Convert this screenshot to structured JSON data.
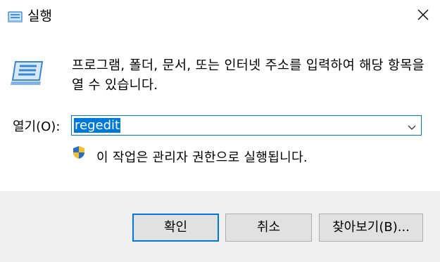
{
  "window": {
    "title": "실행",
    "close_icon": "close-icon",
    "app_icon": "run-icon"
  },
  "main": {
    "description_line1": "프로그램, 폴더, 문서, 또는 인터넷 주소를 입력하여 해당 항목을",
    "description_line2": "열 수 있습니다.",
    "open_label": "열기(O):",
    "open_value": "regedit",
    "admin_note": "이 작업은 관리자 권한으로 실행됩니다."
  },
  "buttons": {
    "ok": "확인",
    "cancel": "취소",
    "browse": "찾아보기(B)..."
  },
  "colors": {
    "accent": "#0078d7",
    "footer": "#f0f0f0",
    "button": "#e1e1e1"
  }
}
